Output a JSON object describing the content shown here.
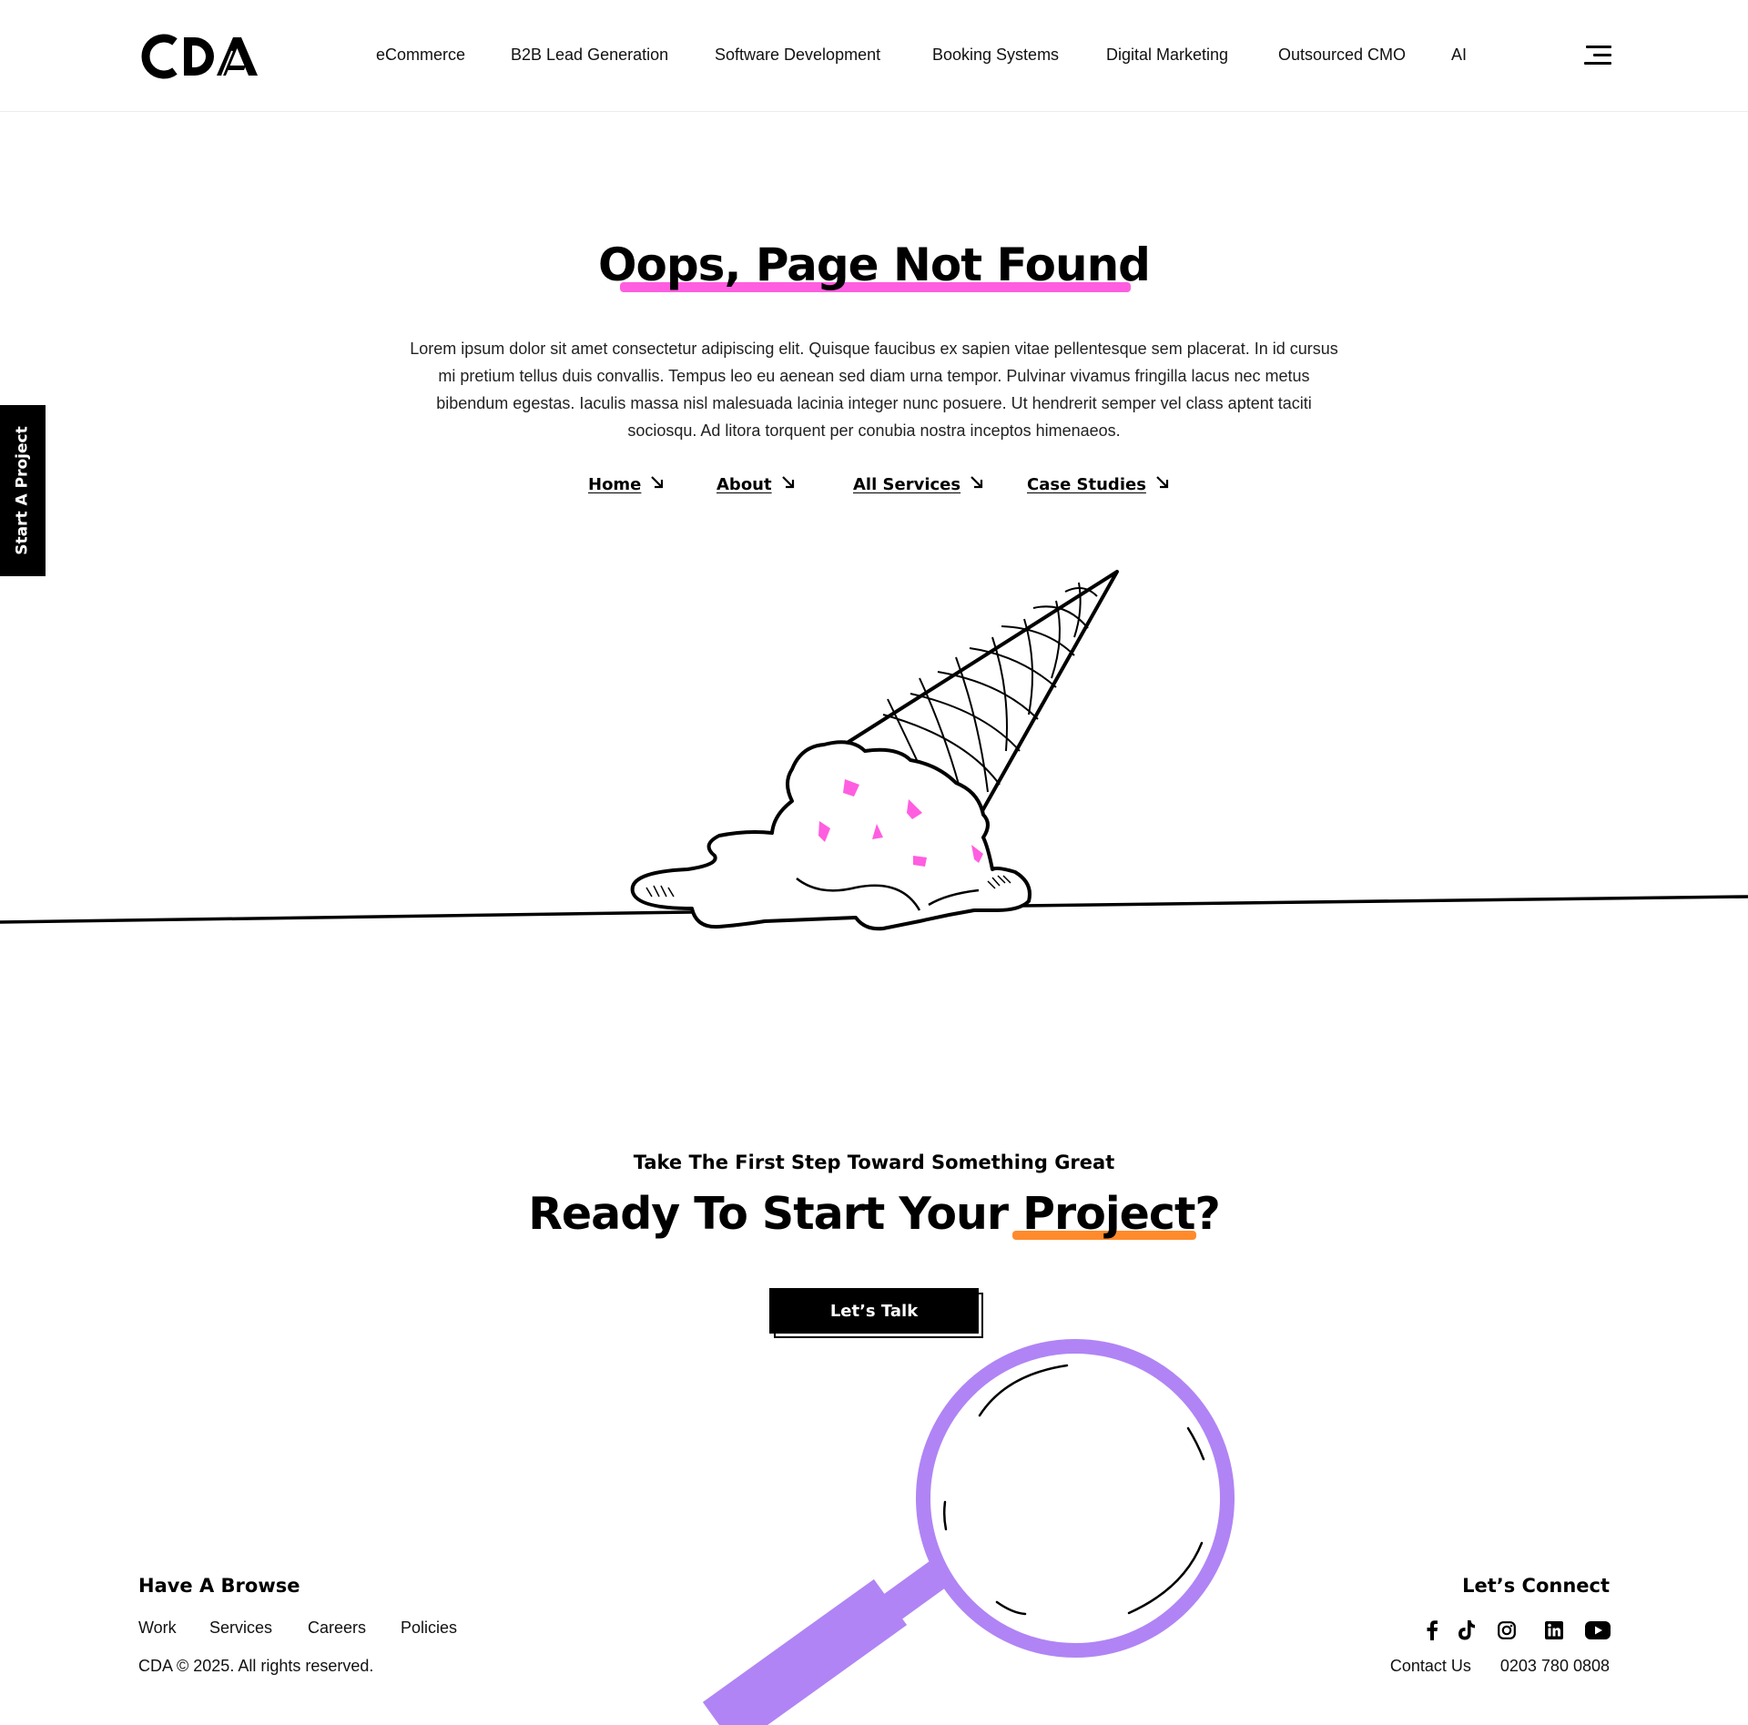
{
  "header": {
    "logo_text": "CDA",
    "nav": [
      {
        "label": "eCommerce"
      },
      {
        "label": "B2B Lead Generation"
      },
      {
        "label": "Software Development"
      },
      {
        "label": "Booking Systems"
      },
      {
        "label": "Digital Marketing"
      },
      {
        "label": "Outsourced CMO"
      },
      {
        "label": "AI"
      }
    ],
    "menu_icon": "hamburger-menu-icon"
  },
  "side_tab": {
    "label": "Start A Project"
  },
  "hero": {
    "title": "Oops, Page Not Found",
    "underline_color": "#ff5ee0",
    "body": "Lorem ipsum dolor sit amet consectetur adipiscing elit. Quisque faucibus ex sapien vitae pellentesque sem placerat. In id cursus mi pretium tellus duis convallis. Tempus leo eu aenean sed diam urna tempor. Pulvinar vivamus fringilla lacus nec metus bibendum egestas. Iaculis massa nisl malesuada lacinia integer nunc posuere. Ut hendrerit semper vel class aptent taciti sociosqu. Ad litora torquent per conubia nostra inceptos himenaeos.",
    "links": [
      {
        "label": "Home",
        "icon": "arrow-down-right-icon"
      },
      {
        "label": "About",
        "icon": "arrow-down-right-icon"
      },
      {
        "label": "All Services",
        "icon": "arrow-down-right-icon"
      },
      {
        "label": "Case Studies",
        "icon": "arrow-down-right-icon"
      }
    ],
    "illustration": "dropped-ice-cream-cone",
    "sprinkle_color": "#ff5ee0"
  },
  "cta": {
    "subtitle": "Take The First Step Toward Something Great",
    "title_main": "Ready To Start Your ",
    "title_highlight": "Project?",
    "underline_color": "#ff8a2b",
    "button_label": "Let’s Talk",
    "illustration": "magnifying-glass",
    "illustration_color": "#b084f5"
  },
  "footer": {
    "browse_title": "Have A Browse",
    "links": [
      {
        "label": "Work"
      },
      {
        "label": "Services"
      },
      {
        "label": "Careers"
      },
      {
        "label": "Policies"
      }
    ],
    "copyright": "CDA © 2025. All rights reserved.",
    "connect_title": "Let’s Connect",
    "socials": [
      "facebook-icon",
      "tiktok-icon",
      "instagram-icon",
      "linkedin-icon",
      "youtube-icon"
    ],
    "contact_label": "Contact Us",
    "phone": "0203 780 0808"
  }
}
